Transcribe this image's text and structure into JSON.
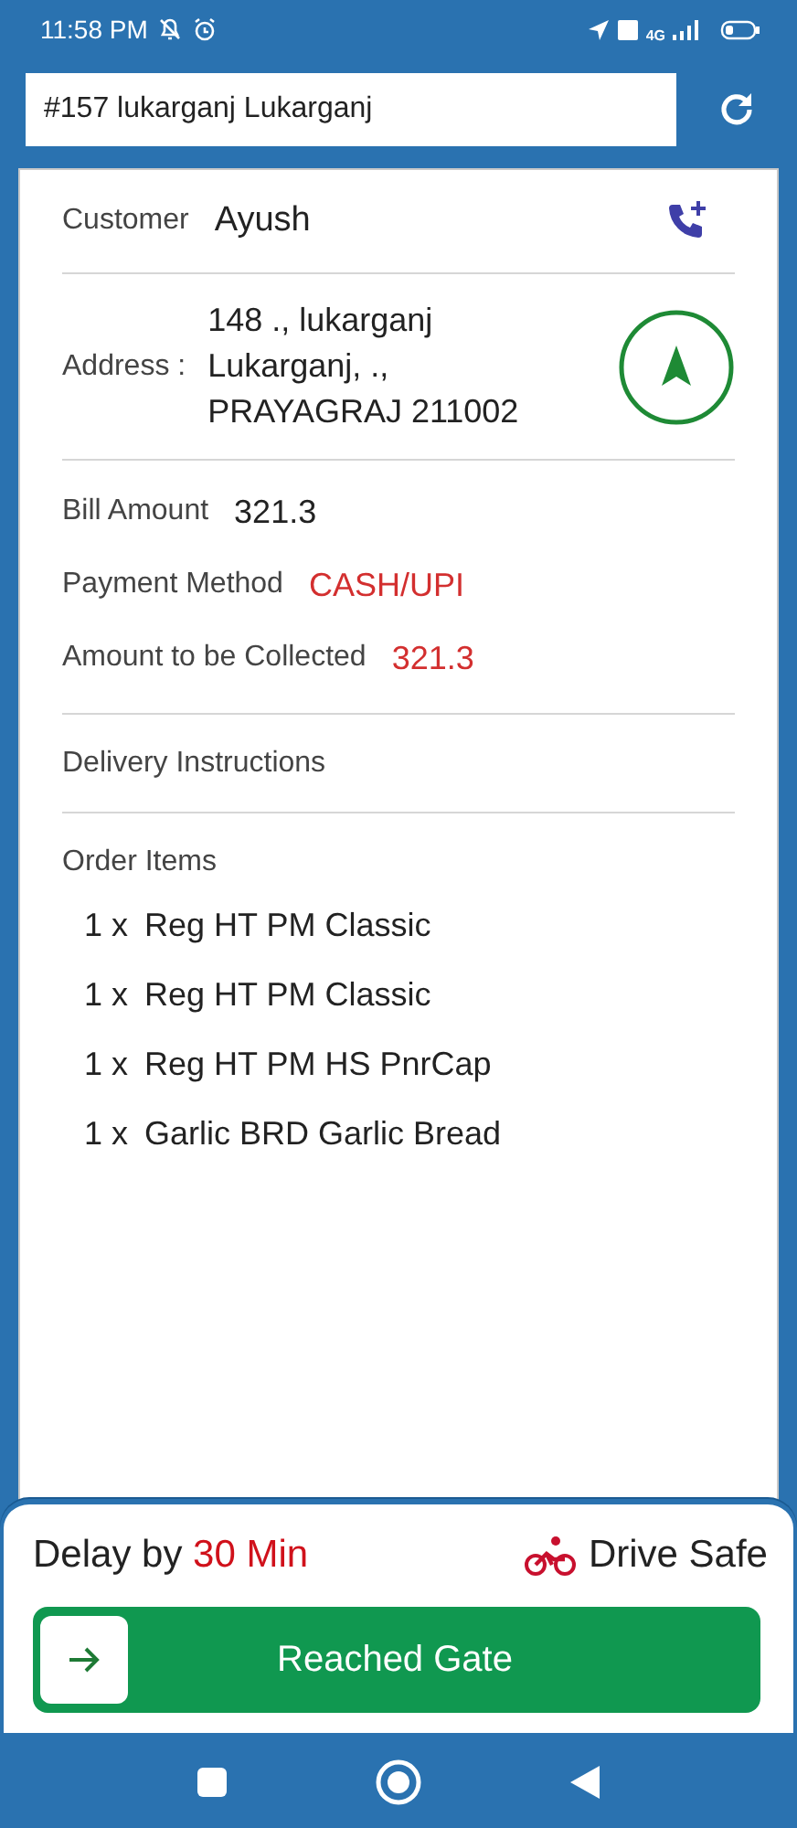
{
  "status_bar": {
    "time": "11:58 PM",
    "network": "4G"
  },
  "header": {
    "order_field": {
      "value": "#157 lukarganj Lukarganj"
    }
  },
  "customer": {
    "label": "Customer",
    "name": "Ayush"
  },
  "address": {
    "label": "Address :",
    "lines": [
      "148 ., lukarganj",
      "Lukarganj, .,",
      "PRAYAGRAJ 211002"
    ]
  },
  "billing": [
    {
      "label": "Bill Amount",
      "value": "321.3",
      "kind": "plain"
    },
    {
      "label": "Payment Method",
      "value": "CASH/UPI",
      "kind": "alert"
    },
    {
      "label": "Amount to be Collected",
      "value": "321.3",
      "kind": "alert"
    }
  ],
  "delivery_instructions": {
    "label": "Delivery Instructions"
  },
  "order_items": {
    "title": "Order Items",
    "items": [
      {
        "qty": "1 x",
        "name": "Reg HT PM Classic"
      },
      {
        "qty": "1 x",
        "name": "Reg HT PM Classic"
      },
      {
        "qty": "1 x",
        "name": "Reg HT PM HS PnrCap"
      },
      {
        "qty": "1 x",
        "name": "Garlic BRD Garlic Bread"
      }
    ]
  },
  "footer": {
    "delay_label": "Delay by",
    "delay_value": "30 Min",
    "drive_safe": "Drive Safe",
    "action_button": "Reached Gate"
  }
}
